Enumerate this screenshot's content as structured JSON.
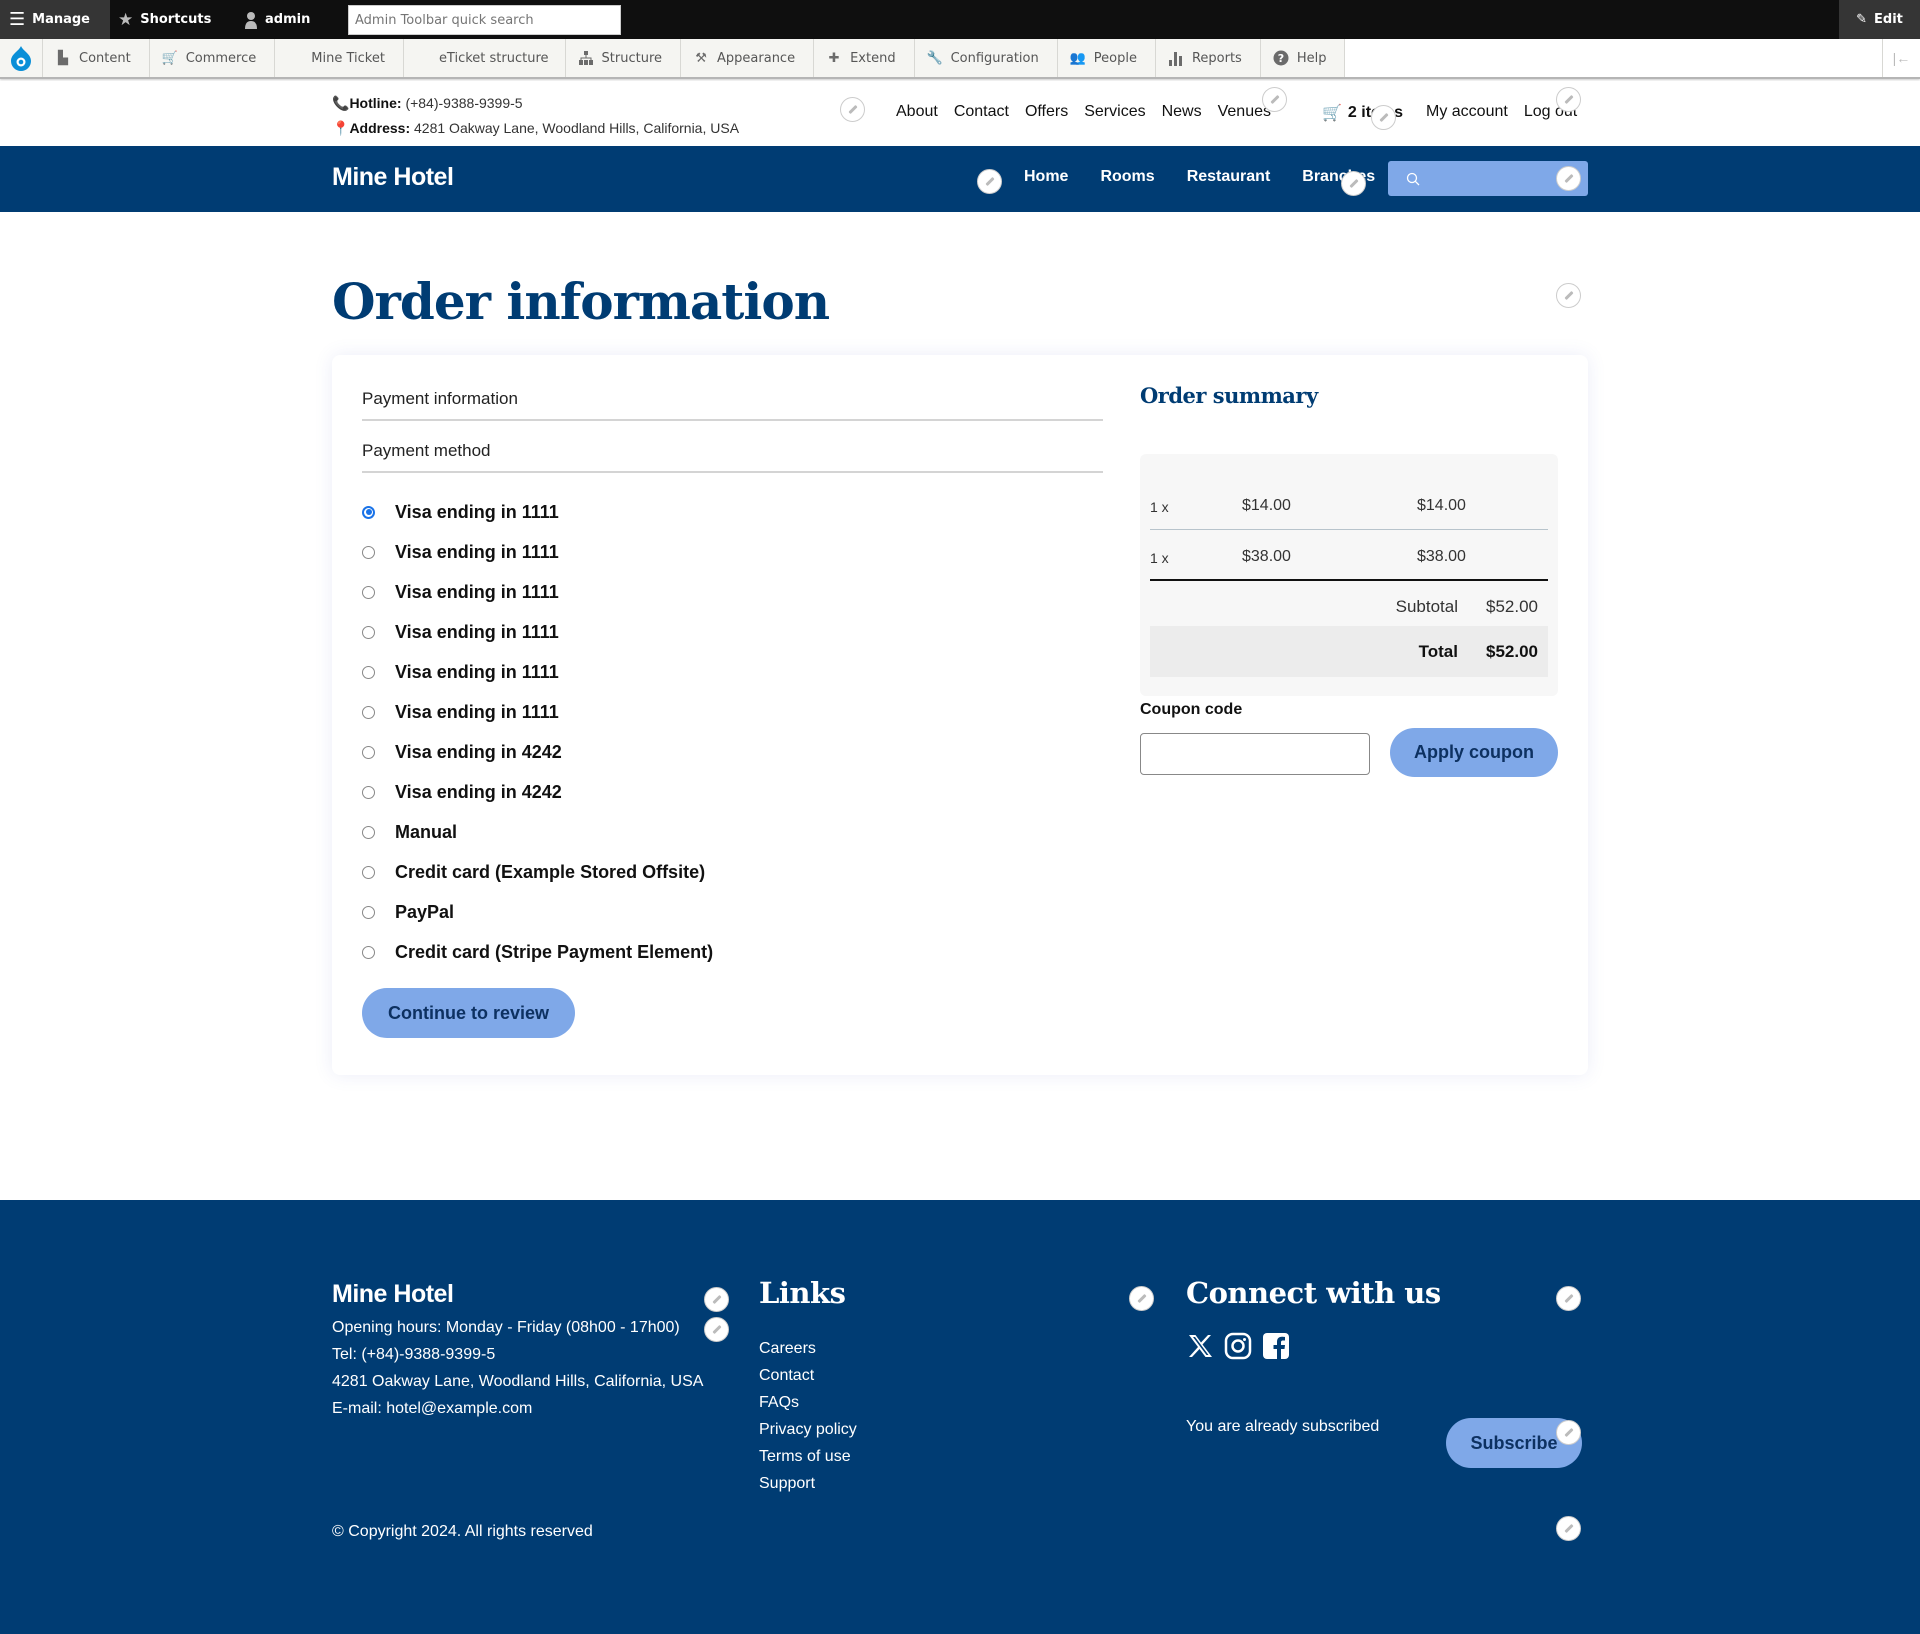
{
  "admin_toolbar": {
    "manage": "Manage",
    "shortcuts": "Shortcuts",
    "user": "admin",
    "search_placeholder": "Admin Toolbar quick search",
    "edit": "Edit",
    "menu": [
      {
        "label": "Content",
        "icon": "file-icon"
      },
      {
        "label": "Commerce",
        "icon": "cart-icon"
      },
      {
        "label": "Mine Ticket",
        "icon": ""
      },
      {
        "label": "eTicket structure",
        "icon": ""
      },
      {
        "label": "Structure",
        "icon": "sitemap-icon"
      },
      {
        "label": "Appearance",
        "icon": "paintbrush-icon"
      },
      {
        "label": "Extend",
        "icon": "puzzle-icon"
      },
      {
        "label": "Configuration",
        "icon": "wrench-icon"
      },
      {
        "label": "People",
        "icon": "people-icon"
      },
      {
        "label": "Reports",
        "icon": "bar-chart-icon"
      },
      {
        "label": "Help",
        "icon": "help-icon"
      }
    ]
  },
  "infobar": {
    "hotline_label": "Hotline:",
    "hotline": "(+84)-9388-9399-5",
    "address_label": "Address:",
    "address": "4281 Oakway Lane, Woodland Hills, California, USA",
    "secondary_nav": [
      "About",
      "Contact",
      "Offers",
      "Services",
      "News",
      "Venues"
    ],
    "cart": "2 items",
    "account": [
      "My account",
      "Log out"
    ]
  },
  "mainnav": {
    "brand": "Mine Hotel",
    "links": [
      "Home",
      "Rooms",
      "Restaurant",
      "Branches"
    ],
    "search_placeholder": ""
  },
  "page": {
    "title": "Order information",
    "payment_information": "Payment information",
    "payment_method": "Payment method",
    "payment_options": [
      {
        "label": "Visa ending in 1111",
        "checked": true
      },
      {
        "label": "Visa ending in 1111",
        "checked": false
      },
      {
        "label": "Visa ending in 1111",
        "checked": false
      },
      {
        "label": "Visa ending in 1111",
        "checked": false
      },
      {
        "label": "Visa ending in 1111",
        "checked": false
      },
      {
        "label": "Visa ending in 1111",
        "checked": false
      },
      {
        "label": "Visa ending in 4242",
        "checked": false
      },
      {
        "label": "Visa ending in 4242",
        "checked": false
      },
      {
        "label": "Manual",
        "checked": false
      },
      {
        "label": "Credit card (Example Stored Offsite)",
        "checked": false
      },
      {
        "label": "PayPal",
        "checked": false
      },
      {
        "label": "Credit card (Stripe Payment Element)",
        "checked": false
      }
    ],
    "continue_button": "Continue to review"
  },
  "order_summary": {
    "title": "Order summary",
    "items": [
      {
        "qty": "1 x",
        "unit_price": "$14.00",
        "total": "$14.00"
      },
      {
        "qty": "1 x",
        "unit_price": "$38.00",
        "total": "$38.00"
      }
    ],
    "subtotal_label": "Subtotal",
    "subtotal": "$52.00",
    "total_label": "Total",
    "total": "$52.00",
    "coupon_label": "Coupon code",
    "coupon_value": "",
    "apply_button": "Apply coupon"
  },
  "footer": {
    "brand": "Mine Hotel",
    "info": [
      "Opening hours: Monday - Friday (08h00 - 17h00)",
      "Tel: (+84)-9388-9399-5",
      "4281 Oakway Lane, Woodland Hills, California, USA",
      "E-mail: hotel@example.com"
    ],
    "links_title": "Links",
    "links": [
      "Careers",
      "Contact",
      "FAQs",
      "Privacy policy",
      "Terms of use",
      "Support"
    ],
    "connect_title": "Connect with us",
    "social": [
      "x-icon",
      "instagram-icon",
      "facebook-icon"
    ],
    "subscribed_text": "You are already subscribed",
    "subscribe_button": "Subscribe",
    "copyright": "© Copyright 2024. All rights reserved"
  },
  "colors": {
    "brand_navy": "#003c73",
    "button_blue": "#7fa8e8",
    "radio_checked": "#1a73e8"
  }
}
